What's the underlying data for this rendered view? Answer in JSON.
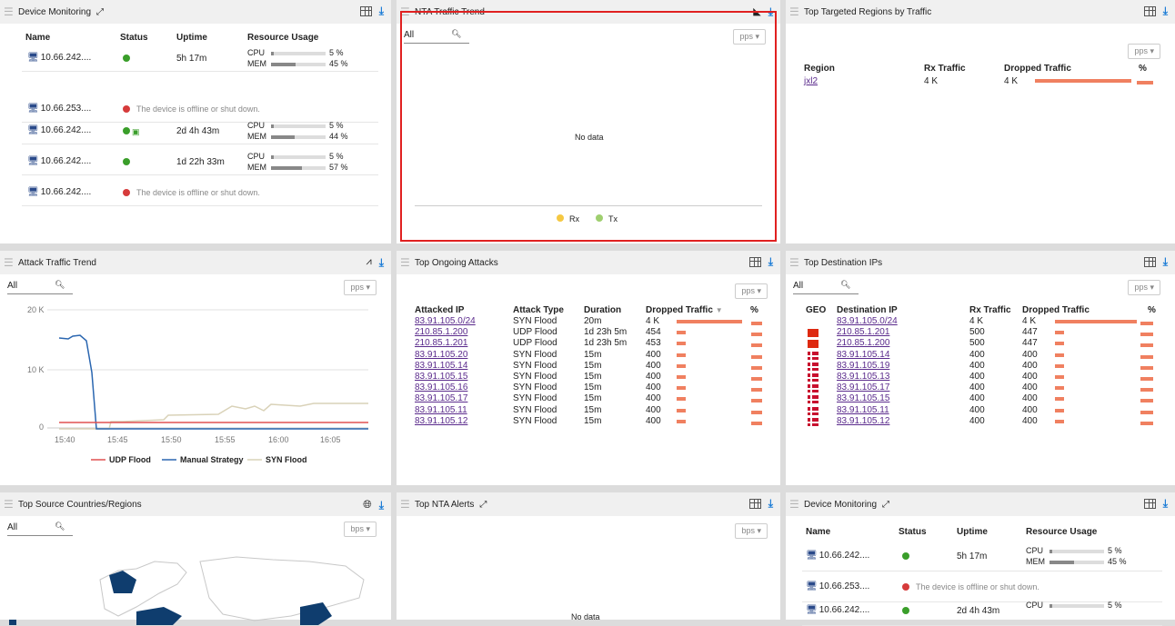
{
  "panels": {
    "device_monitoring": {
      "title": "Device Monitoring",
      "columns": [
        "Name",
        "Status",
        "Uptime",
        "Resource Usage"
      ],
      "rows": [
        {
          "name": "10.66.242....",
          "uptime": "5h 17m",
          "cpu": "5 %",
          "mem": "45 %",
          "cpu_frac": 0.05,
          "mem_frac": 0.45,
          "online": true
        },
        {
          "name": "10.66.253....",
          "offline_msg": "The device is offline or shut down.",
          "online": false
        },
        {
          "name": "10.66.242....",
          "uptime": "2d 4h 43m",
          "cpu": "5 %",
          "mem": "44 %",
          "cpu_frac": 0.05,
          "mem_frac": 0.44,
          "online": true
        },
        {
          "name": "10.66.242....",
          "uptime": "1d 22h 33m",
          "cpu": "5 %",
          "mem": "57 %",
          "cpu_frac": 0.05,
          "mem_frac": 0.57,
          "online": true
        },
        {
          "name": "10.66.242....",
          "offline_msg": "The device is offline or shut down.",
          "online": false
        }
      ],
      "cpu_label": "CPU",
      "mem_label": "MEM"
    },
    "nta_traffic": {
      "title": "NTA Traffic Trend",
      "filter": "All",
      "unit": "pps",
      "nodata": "No data",
      "legend": [
        "Rx",
        "Tx"
      ]
    },
    "top_regions": {
      "title": "Top Targeted Regions by Traffic",
      "unit": "pps",
      "columns": [
        "Region",
        "Rx Traffic",
        "Dropped Traffic",
        "%"
      ],
      "rows": [
        {
          "region": "jxl2",
          "rx": "4 K",
          "dropped": "4 K",
          "frac": 1.0
        }
      ]
    },
    "attack_trend": {
      "title": "Attack Traffic Trend",
      "filter": "All",
      "unit": "pps",
      "yticks": [
        "20 K",
        "10 K",
        "0"
      ],
      "xticks": [
        "15:40",
        "15:45",
        "15:50",
        "15:55",
        "16:00",
        "16:05"
      ],
      "legend": [
        "UDP Flood",
        "Manual Strategy",
        "SYN Flood"
      ]
    },
    "ongoing_attacks": {
      "title": "Top Ongoing Attacks",
      "unit": "pps",
      "columns": [
        "Attacked IP",
        "Attack Type",
        "Duration",
        "Dropped Traffic",
        "%"
      ],
      "rows": [
        {
          "ip": "83.91.105.0/24",
          "type": "SYN Flood",
          "dur": "20m",
          "dropped": "4 K",
          "frac": 1.0
        },
        {
          "ip": "210.85.1.200",
          "type": "UDP Flood",
          "dur": "1d 23h 5m",
          "dropped": "454",
          "frac": 0.11
        },
        {
          "ip": "210.85.1.201",
          "type": "UDP Flood",
          "dur": "1d 23h 5m",
          "dropped": "453",
          "frac": 0.11
        },
        {
          "ip": "83.91.105.20",
          "type": "SYN Flood",
          "dur": "15m",
          "dropped": "400",
          "frac": 0.1
        },
        {
          "ip": "83.91.105.14",
          "type": "SYN Flood",
          "dur": "15m",
          "dropped": "400",
          "frac": 0.1
        },
        {
          "ip": "83.91.105.15",
          "type": "SYN Flood",
          "dur": "15m",
          "dropped": "400",
          "frac": 0.1
        },
        {
          "ip": "83.91.105.16",
          "type": "SYN Flood",
          "dur": "15m",
          "dropped": "400",
          "frac": 0.1
        },
        {
          "ip": "83.91.105.17",
          "type": "SYN Flood",
          "dur": "15m",
          "dropped": "400",
          "frac": 0.1
        },
        {
          "ip": "83.91.105.11",
          "type": "SYN Flood",
          "dur": "15m",
          "dropped": "400",
          "frac": 0.1
        },
        {
          "ip": "83.91.105.12",
          "type": "SYN Flood",
          "dur": "15m",
          "dropped": "400",
          "frac": 0.1
        }
      ]
    },
    "dest_ips": {
      "title": "Top Destination IPs",
      "filter": "All",
      "unit": "pps",
      "columns": [
        "GEO",
        "Destination IP",
        "Rx Traffic",
        "Dropped Traffic",
        "%"
      ],
      "rows": [
        {
          "flag": "",
          "ip": "83.91.105.0/24",
          "rx": "4 K",
          "dropped": "4 K",
          "frac": 1.0
        },
        {
          "flag": "cn",
          "ip": "210.85.1.201",
          "rx": "500",
          "dropped": "447",
          "frac": 0.11
        },
        {
          "flag": "cn",
          "ip": "210.85.1.200",
          "rx": "500",
          "dropped": "447",
          "frac": 0.11
        },
        {
          "flag": "dk",
          "ip": "83.91.105.14",
          "rx": "400",
          "dropped": "400",
          "frac": 0.1
        },
        {
          "flag": "dk",
          "ip": "83.91.105.19",
          "rx": "400",
          "dropped": "400",
          "frac": 0.1
        },
        {
          "flag": "dk",
          "ip": "83.91.105.13",
          "rx": "400",
          "dropped": "400",
          "frac": 0.1
        },
        {
          "flag": "dk",
          "ip": "83.91.105.17",
          "rx": "400",
          "dropped": "400",
          "frac": 0.1
        },
        {
          "flag": "dk",
          "ip": "83.91.105.15",
          "rx": "400",
          "dropped": "400",
          "frac": 0.1
        },
        {
          "flag": "dk",
          "ip": "83.91.105.11",
          "rx": "400",
          "dropped": "400",
          "frac": 0.1
        },
        {
          "flag": "dk",
          "ip": "83.91.105.12",
          "rx": "400",
          "dropped": "400",
          "frac": 0.1
        }
      ]
    },
    "source_countries": {
      "title": "Top Source Countries/Regions",
      "filter": "All",
      "unit": "bps"
    },
    "nta_alerts": {
      "title": "Top NTA Alerts",
      "unit": "bps",
      "nodata": "No data"
    },
    "device_monitoring2": {
      "title": "Device Monitoring",
      "columns": [
        "Name",
        "Status",
        "Uptime",
        "Resource Usage"
      ],
      "rows": [
        {
          "name": "10.66.242....",
          "uptime": "5h 17m",
          "cpu": "5 %",
          "mem": "45 %"
        },
        {
          "name": "10.66.253....",
          "offline_msg": "The device is offline or shut down."
        },
        {
          "name": "10.66.242....",
          "uptime": "2d 4h 43m",
          "cpu": "5 %"
        }
      ],
      "cpu_label": "CPU",
      "mem_label": "MEM"
    }
  },
  "colors": {
    "highlight_border": "#e02020",
    "drop_bar": "#f08060",
    "udp": "#e05050",
    "manual": "#2a66b0",
    "syn": "#d9d2b8"
  }
}
